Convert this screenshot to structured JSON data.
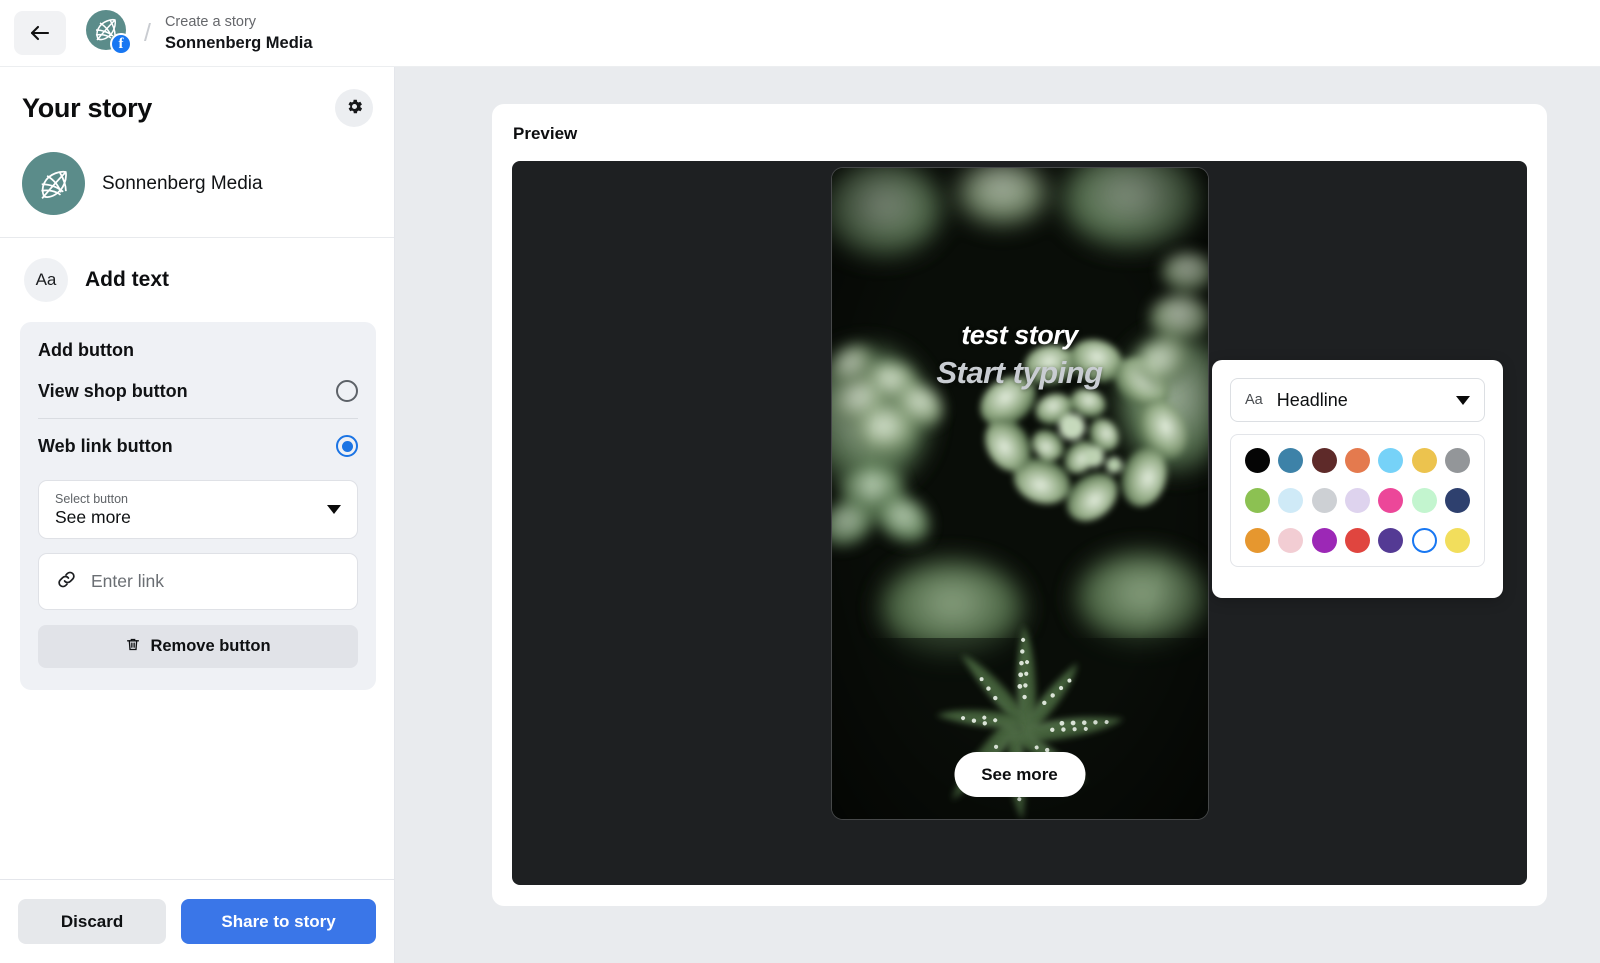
{
  "topbar": {
    "back_icon": "arrow-left-icon",
    "brand_icon": "sonnenberg-leaf-logo",
    "facebook_badge": "f",
    "separator": "/",
    "breadcrumb_top": "Create a story",
    "breadcrumb_bottom": "Sonnenberg Media"
  },
  "sidebar": {
    "title": "Your story",
    "settings_icon": "gear-icon",
    "account": {
      "avatar_icon": "sonnenberg-leaf-logo",
      "name": "Sonnenberg Media"
    },
    "add_text": {
      "icon_label": "Aa",
      "label": "Add text"
    },
    "add_button_panel": {
      "title": "Add button",
      "options": [
        {
          "label": "View shop button",
          "selected": false
        },
        {
          "label": "Web link button",
          "selected": true
        }
      ],
      "select_button": {
        "caption": "Select button",
        "value": "See more",
        "caret_icon": "chevron-down-icon"
      },
      "link_input": {
        "icon": "link-icon",
        "placeholder": "Enter link",
        "value": ""
      },
      "remove_button": {
        "icon": "trash-icon",
        "label": "Remove button"
      }
    },
    "footer": {
      "discard_label": "Discard",
      "share_label": "Share to story",
      "share_color": "#3a76e8"
    }
  },
  "preview": {
    "label": "Preview",
    "story": {
      "image_description": "succulent-plants-photo",
      "text_line_1": "test story",
      "text_line_2": "Start typing",
      "text_line_1_color": "#ffffff",
      "text_line_2_color": "#c9cdd2",
      "cta_label": "See more"
    }
  },
  "color_popover": {
    "font_icon_label": "Aa",
    "font_name": "Headline",
    "caret_icon": "chevron-down-icon",
    "swatch_rows": [
      [
        "#050505",
        "#3d82a8",
        "#5e2a29",
        "#e47a4e",
        "#76d2f8",
        "#ecc34e",
        "#939699"
      ],
      [
        "#8cc152",
        "#cfeaf7",
        "#cdd0d4",
        "#ded3ee",
        "#ec4799",
        "#c3f5cf",
        "#2e406e"
      ],
      [
        "#e6972f",
        "#f2cdd3",
        "#9c28b6",
        "#e0453f",
        "#543a94",
        "#ffffff",
        "#f2de5c"
      ]
    ],
    "selected_swatch": {
      "row": 2,
      "index": 5,
      "color": "#ffffff",
      "ring_color": "#1877f2"
    }
  }
}
